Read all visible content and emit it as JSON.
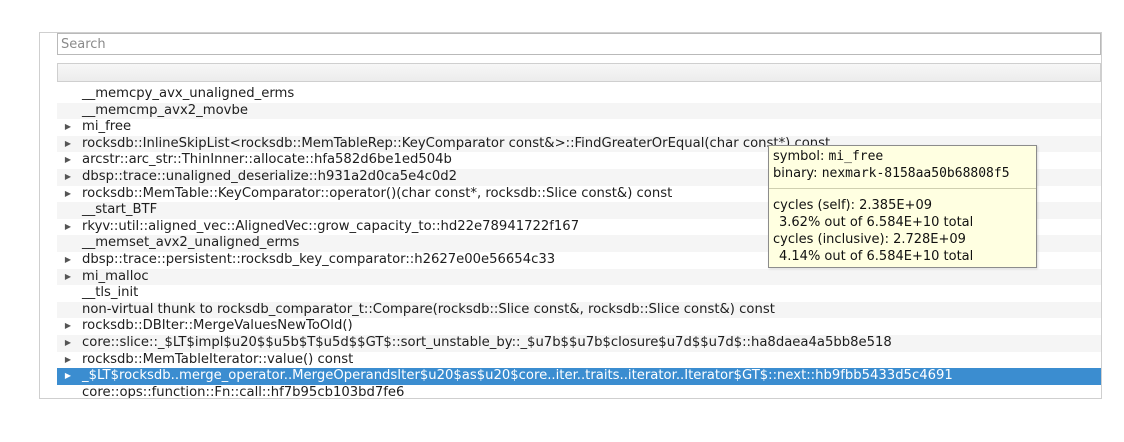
{
  "search": {
    "placeholder": "Search"
  },
  "rows": [
    {
      "label": "__memcpy_avx_unaligned_erms",
      "expandable": false
    },
    {
      "label": "__memcmp_avx2_movbe",
      "expandable": false
    },
    {
      "label": "mi_free",
      "expandable": true
    },
    {
      "label": "rocksdb::InlineSkipList<rocksdb::MemTableRep::KeyComparator const&>::FindGreaterOrEqual(char const*) const",
      "expandable": true
    },
    {
      "label": "arcstr::arc_str::ThinInner::allocate::hfa582d6be1ed504b",
      "expandable": true
    },
    {
      "label": "dbsp::trace::unaligned_deserialize::h931a2d0ca5e4c0d2",
      "expandable": true
    },
    {
      "label": "rocksdb::MemTable::KeyComparator::operator()(char const*, rocksdb::Slice const&) const",
      "expandable": true
    },
    {
      "label": "__start_BTF",
      "expandable": false
    },
    {
      "label": "rkyv::util::aligned_vec::AlignedVec::grow_capacity_to::hd22e78941722f167",
      "expandable": true
    },
    {
      "label": "__memset_avx2_unaligned_erms",
      "expandable": false
    },
    {
      "label": "dbsp::trace::persistent::rocksdb_key_comparator::h2627e00e56654c33",
      "expandable": true
    },
    {
      "label": "mi_malloc",
      "expandable": true
    },
    {
      "label": "__tls_init",
      "expandable": false
    },
    {
      "label": "non-virtual thunk to rocksdb_comparator_t::Compare(rocksdb::Slice const&, rocksdb::Slice const&) const",
      "expandable": false
    },
    {
      "label": "rocksdb::DBIter::MergeValuesNewToOld()",
      "expandable": true
    },
    {
      "label": "core::slice::_$LT$impl$u20$$u5b$T$u5d$$GT$::sort_unstable_by::_$u7b$$u7b$closure$u7d$$u7d$::ha8daea4a5bb8e518",
      "expandable": true
    },
    {
      "label": "rocksdb::MemTableIterator::value() const",
      "expandable": true
    },
    {
      "label": "_$LT$rocksdb..merge_operator..MergeOperandsIter$u20$as$u20$core..iter..traits..iterator..Iterator$GT$::next::hb9fbb5433d5c4691",
      "expandable": true,
      "selected": true
    },
    {
      "label": "core::ops::function::Fn::call::hf7b95cb103bd7fe6",
      "expandable": false
    }
  ],
  "tooltip": {
    "symbol_label": "symbol:",
    "symbol_value": "mi_free",
    "binary_label": "binary:",
    "binary_value": "nexmark-8158aa50b68808f5",
    "cycles_self": "cycles (self): 2.385E+09",
    "cycles_self_pct": "3.62% out of 6.584E+10 total",
    "cycles_inclusive": "cycles (inclusive): 2.728E+09",
    "cycles_inclusive_pct": "4.14% out of 6.584E+10 total"
  },
  "icons": {
    "expand": "triangle-right-icon"
  }
}
